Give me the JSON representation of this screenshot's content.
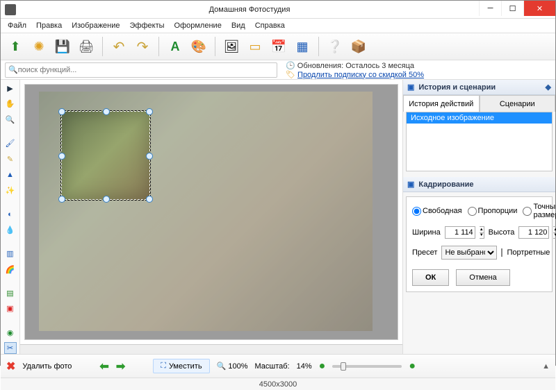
{
  "window": {
    "title": "Домашняя Фотостудия"
  },
  "menu": {
    "file": "Файл",
    "edit": "Правка",
    "image": "Изображение",
    "effects": "Эффекты",
    "design": "Оформление",
    "view": "Вид",
    "help": "Справка"
  },
  "search": {
    "placeholder": "поиск функций..."
  },
  "subscription": {
    "line1": "Обновления: Осталось  3 месяца",
    "line2": "Продлить подписку со скидкой 50%"
  },
  "history_panel": {
    "title": "История и сценарии",
    "tab_hist": "История действий",
    "tab_scen": "Сценарии",
    "items": [
      "Исходное изображение"
    ]
  },
  "crop": {
    "title": "Кадрирование",
    "mode_free": "Свободная",
    "mode_prop": "Пропорции",
    "mode_exact": "Точный размер",
    "width_label": "Ширина",
    "width_val": "1 114",
    "height_label": "Высота",
    "height_val": "1 120",
    "preset_label": "Пресет",
    "preset_val": "Не выбрано",
    "portrait": "Портретные",
    "ok": "ОК",
    "cancel": "Отмена"
  },
  "bottom": {
    "delete": "Удалить фото",
    "fit": "Уместить",
    "pct100": "100%",
    "scale_label": "Масштаб:",
    "scale_val": "14%"
  },
  "status": {
    "dims": "4500x3000"
  },
  "colors": {
    "accent": "#1e90ff",
    "close": "#e43b2f"
  }
}
